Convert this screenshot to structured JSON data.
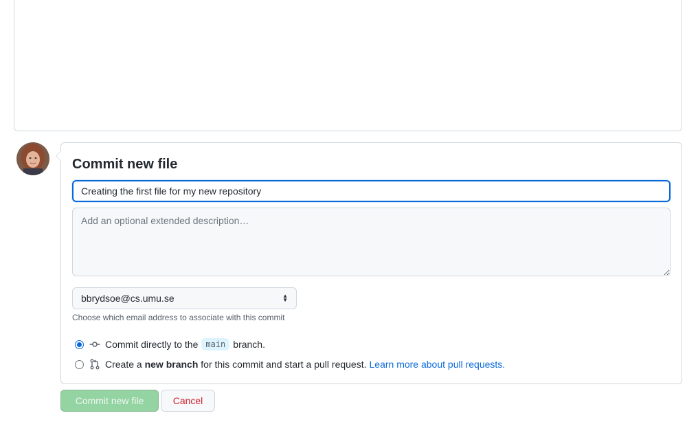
{
  "commit": {
    "title": "Commit new file",
    "summary_value": "Creating the first file for my new repository",
    "description_placeholder": "Add an optional extended description…",
    "email_selected": "bbrydsoe@cs.umu.se",
    "email_hint": "Choose which email address to associate with this commit",
    "option_direct": {
      "prefix": "Commit directly to the",
      "branch": "main",
      "suffix": "branch."
    },
    "option_new_branch": {
      "prefix": "Create a",
      "bold": "new branch",
      "suffix": "for this commit and start a pull request.",
      "link": "Learn more about pull requests."
    },
    "selected_option": "direct"
  },
  "buttons": {
    "commit_label": "Commit new file",
    "cancel_label": "Cancel"
  },
  "colors": {
    "accent": "#0969da",
    "commit_button_disabled": "#94d3a2",
    "cancel_text": "#cf222e",
    "border": "#d0d7de"
  },
  "icons": {
    "avatar": "user-avatar",
    "direct_commit": "git-commit-icon",
    "new_branch": "git-pull-request-icon"
  }
}
